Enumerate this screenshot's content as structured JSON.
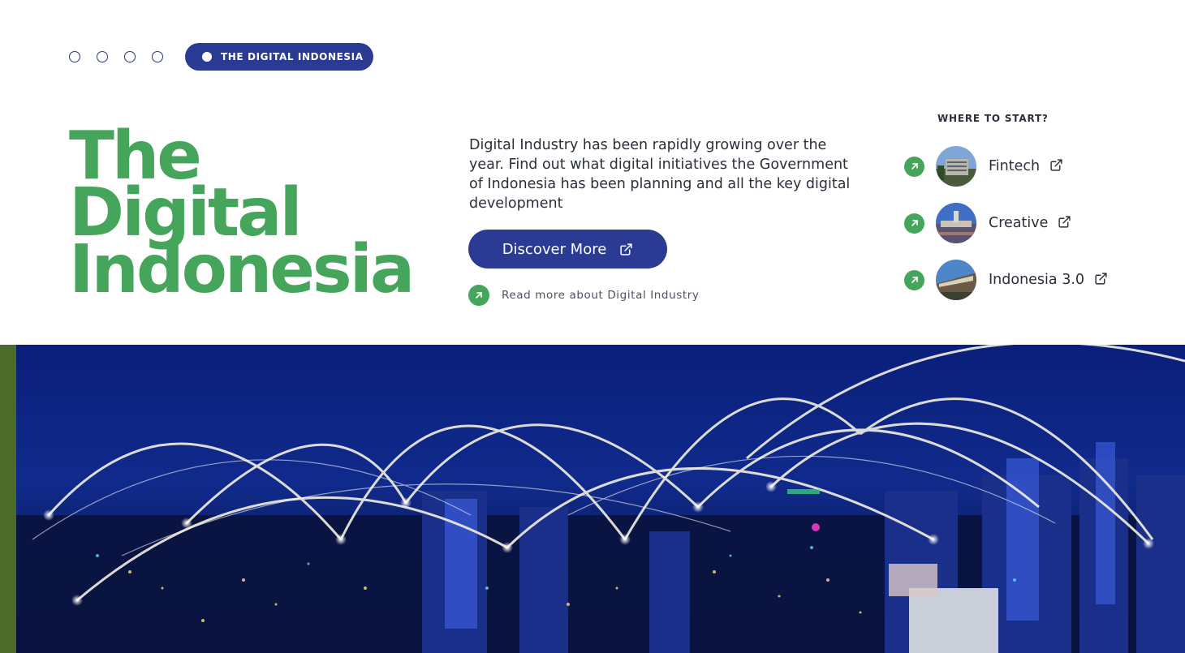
{
  "slider": {
    "dots": 4,
    "active_label": "THE DIGITAL INDONESIA"
  },
  "hero": {
    "title_lines": [
      "The",
      "Digital",
      "Indonesia"
    ],
    "description": "Digital Industry has been rapidly growing over the year. Find out what digital initiatives the Government of Indonesia has been planning and all the key digital development",
    "discover_label": "Discover More",
    "read_more_label": "Read more about Digital Industry"
  },
  "where_to_start": {
    "heading": "WHERE TO START?",
    "items": [
      {
        "label": "Fintech",
        "icon": "external-link-icon"
      },
      {
        "label": "Creative",
        "icon": "external-link-icon"
      },
      {
        "label": "Indonesia 3.0",
        "icon": "external-link-icon"
      }
    ]
  },
  "colors": {
    "brand_blue": "#2b3a93",
    "brand_green": "#45a55a",
    "night_sky": "#0a1f7a"
  }
}
